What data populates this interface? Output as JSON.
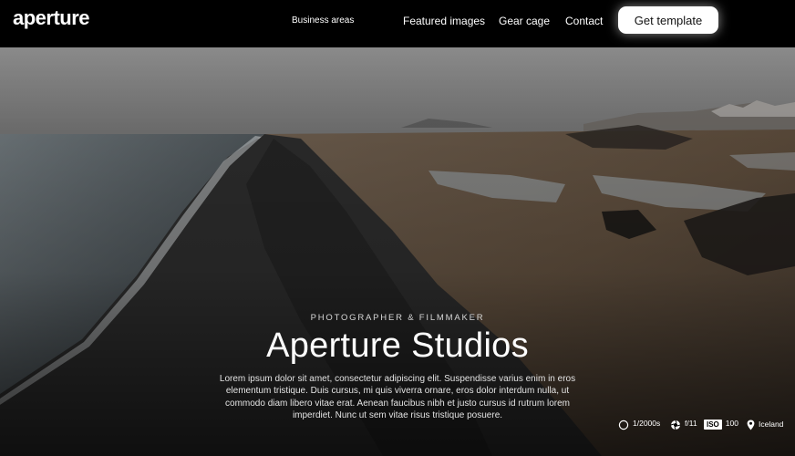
{
  "brand": {
    "logo": "aperture"
  },
  "nav": {
    "links": [
      "Business areas",
      "Featured images",
      "Gear cage",
      "Contact"
    ],
    "cta": "Get template"
  },
  "hero": {
    "eyebrow": "PHOTOGRAPHER & FILMMAKER",
    "title": "Aperture Studios",
    "description": "Lorem ipsum dolor sit amet, consectetur adipiscing elit. Suspendisse varius enim in eros elementum tristique. Duis cursus, mi quis viverra ornare, eros dolor interdum nulla, ut commodo diam libero vitae erat. Aenean faucibus nibh et justo cursus id rutrum lorem imperdiet. Nunc ut sem vitae risus tristique posuere."
  },
  "exif": {
    "shutter": "1/2000s",
    "aperture": "f/11",
    "iso_label": "ISO",
    "iso": "100",
    "location": "Iceland"
  },
  "icons": [
    "shutter-icon",
    "aperture-icon",
    "iso-icon",
    "location-pin-icon"
  ]
}
